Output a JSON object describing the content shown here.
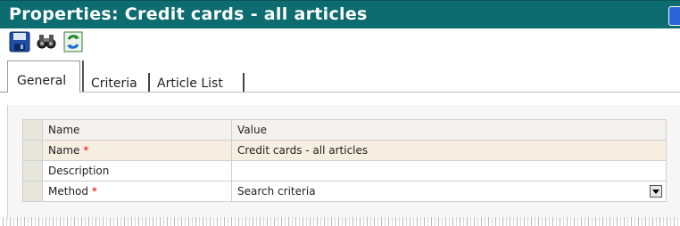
{
  "window": {
    "title": "Properties: Credit cards - all articles"
  },
  "toolbar": {
    "buttons": [
      {
        "icon": "save-icon"
      },
      {
        "icon": "binoculars-icon"
      },
      {
        "icon": "refresh-icon"
      }
    ]
  },
  "tabs": [
    {
      "label": "General",
      "active": true
    },
    {
      "label": "Criteria",
      "active": false
    },
    {
      "label": "Article List",
      "active": false
    }
  ],
  "grid": {
    "headers": {
      "name": "Name",
      "value": "Value"
    },
    "rows": [
      {
        "name": "Name",
        "required_mark": "*",
        "value": "Credit cards - all articles"
      },
      {
        "name": "Description",
        "required_mark": "",
        "value": ""
      },
      {
        "name": "Method",
        "required_mark": "*",
        "value": "Search criteria"
      }
    ]
  },
  "colors": {
    "titlebar": "#0c6c70",
    "required": "#e00000",
    "selected_row": "#f6efe1"
  }
}
